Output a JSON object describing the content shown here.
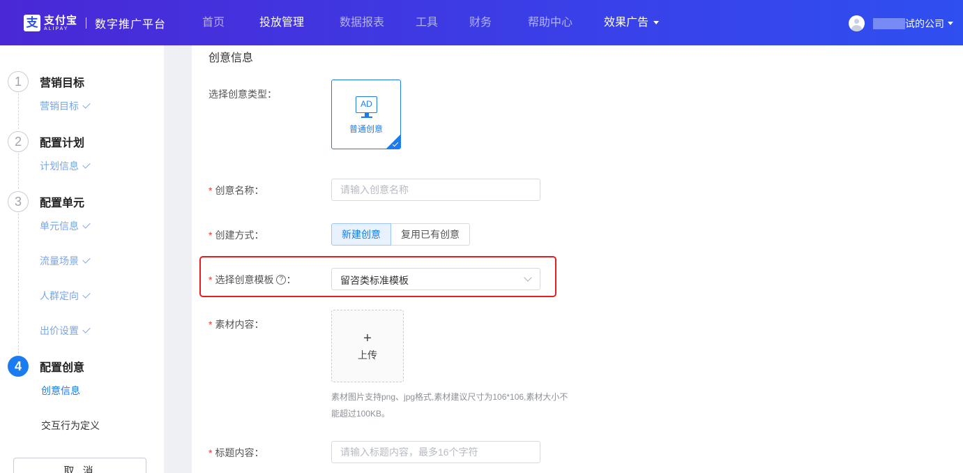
{
  "brand": {
    "logo_glyph": "支",
    "name_cn": "支付宝",
    "name_en": "ALIPAY",
    "separator": "|",
    "platform": "数字推广平台"
  },
  "nav": {
    "items": [
      "首页",
      "投放管理",
      "数据报表",
      "工具",
      "财务",
      "帮助中心"
    ],
    "dropdown": "效果广告",
    "active": "投放管理"
  },
  "user": {
    "company_visible": "试的公司",
    "icon": "user-avatar-icon",
    "caret_icon": "caret-down-icon"
  },
  "steps": [
    {
      "number": "1",
      "title": "营销目标",
      "subs": [
        {
          "label": "营销目标",
          "done": true
        }
      ]
    },
    {
      "number": "2",
      "title": "配置计划",
      "subs": [
        {
          "label": "计划信息",
          "done": true
        }
      ]
    },
    {
      "number": "3",
      "title": "配置单元",
      "subs": [
        {
          "label": "单元信息",
          "done": true
        },
        {
          "label": "流量场景",
          "done": true
        },
        {
          "label": "人群定向",
          "done": true
        },
        {
          "label": "出价设置",
          "done": true
        }
      ]
    },
    {
      "number": "4",
      "title": "配置创意",
      "subs": [
        {
          "label": "创意信息",
          "done": false,
          "current": true
        },
        {
          "label": "交互行为定义",
          "done": false,
          "current": false
        }
      ]
    }
  ],
  "sidebar_cancel": "取 消",
  "form": {
    "section_title": "创意信息",
    "creative_type": {
      "label": "选择创意类型：",
      "card_icon_text": "AD",
      "card_label": "普通创意",
      "selected": true
    },
    "creative_name": {
      "required_mark": "*",
      "label": "创意名称：",
      "placeholder": "请输入创意名称",
      "value": ""
    },
    "create_method": {
      "required_mark": "*",
      "label": "创建方式：",
      "options": [
        "新建创意",
        "复用已有创意"
      ],
      "selected": "新建创意"
    },
    "template": {
      "required_mark": "*",
      "label": "选择创意模板",
      "help_glyph": "?",
      "colon": "：",
      "value": "留咨类标准模板"
    },
    "material": {
      "required_mark": "*",
      "label": "素材内容：",
      "upload_glyph": "+",
      "upload_label": "上传",
      "hint_line1": "素材图片支持png、jpg格式,素材建议尺寸为106*106,素材大小不",
      "hint_line2": "能超过100KB。"
    },
    "title_content": {
      "required_mark": "*",
      "label": "标题内容：",
      "placeholder": "请输入标题内容，最多16个字符",
      "value": ""
    }
  },
  "colors": {
    "nav_gradient_start": "#4a28d6",
    "nav_gradient_end": "#2f4ff0",
    "accent": "#1a7cf0",
    "required": "#e4393c",
    "annotation_box": "#e41d20"
  }
}
